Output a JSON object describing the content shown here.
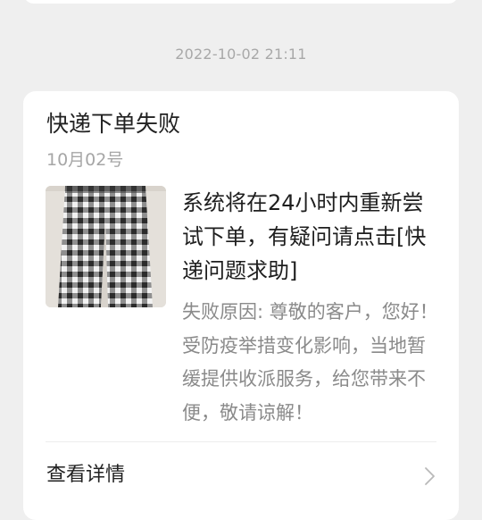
{
  "timestamp": "2022-10-02 21:11",
  "card": {
    "title": "快递下单失败",
    "date": "10月02号",
    "headline": "系统将在24小时内重新尝试下单，有疑问请点击[快递问题求助]",
    "reason": "失败原因: 尊敬的客户，您好！受防疫举措变化影响，当地暂缓提供收派服务，给您带来不便，敬请谅解！",
    "details_label": "查看详情",
    "details_icon": "chevron-right-icon"
  },
  "colors": {
    "background": "#efefef",
    "card": "#ffffff",
    "title_text": "#222222",
    "muted_text": "#a6a6a6",
    "body_text": "#8a8a8a"
  }
}
